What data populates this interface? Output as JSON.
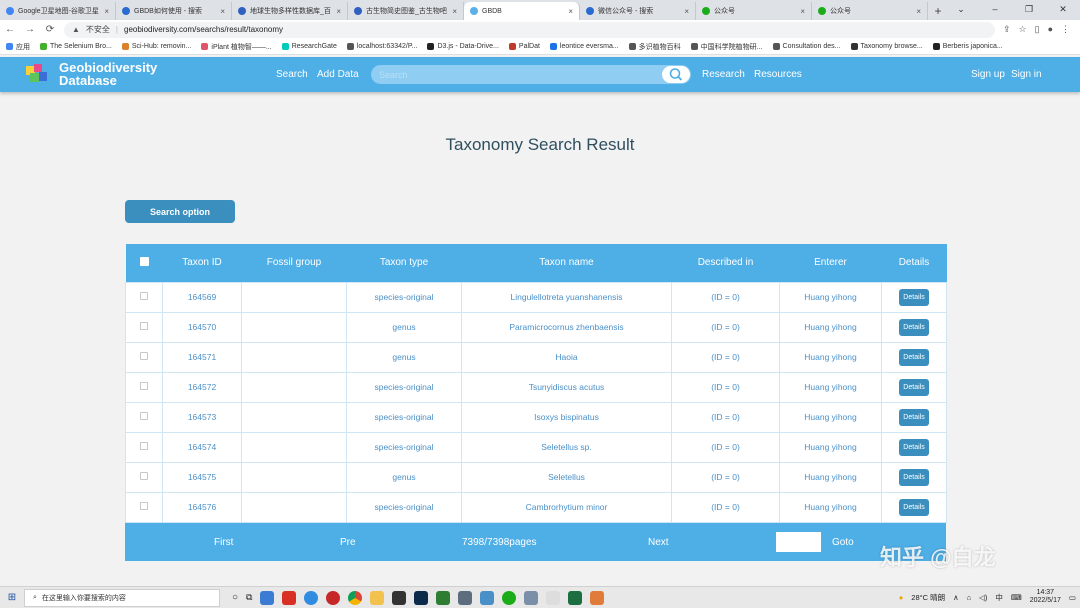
{
  "browser": {
    "tabs": [
      {
        "title": "Google卫星地图-谷歌卫星",
        "color": "#4285f4",
        "active": false
      },
      {
        "title": "GBDB如何使用 - 搜索",
        "color": "#2a6bd1",
        "active": false
      },
      {
        "title": "地球生物多样性数据库_百",
        "color": "#3060c0",
        "active": false
      },
      {
        "title": "古生物简史图鉴_古生物吧",
        "color": "#3060c0",
        "active": false
      },
      {
        "title": "GBDB",
        "color": "#5ab0e8",
        "active": true
      },
      {
        "title": "微信公众号 - 搜索",
        "color": "#2a6bd1",
        "active": false
      },
      {
        "title": "公众号",
        "color": "#1aad19",
        "active": false
      },
      {
        "title": "公众号",
        "color": "#1aad19",
        "active": false
      }
    ],
    "close_glyph": "×",
    "new_tab_glyph": "+",
    "window_controls": [
      "⌄",
      "–",
      "❐",
      "✕"
    ],
    "security_label": "不安全",
    "url": "geobiodiversity.com/searchs/result/taxonomy",
    "bookmarks": [
      {
        "label": "应用",
        "color": "#4285f4"
      },
      {
        "label": "The Selenium Bro...",
        "color": "#43b02a"
      },
      {
        "label": "Sci-Hub: removin...",
        "color": "#d9822b"
      },
      {
        "label": "iPlant 植物智——...",
        "color": "#e0556b"
      },
      {
        "label": "ResearchGate",
        "color": "#00ccbb"
      },
      {
        "label": "localhost:63342/P...",
        "color": "#555555"
      },
      {
        "label": "D3.js - Data-Drive...",
        "color": "#222222"
      },
      {
        "label": "PalDat",
        "color": "#c0392b"
      },
      {
        "label": "leontice eversma...",
        "color": "#1a73e8"
      },
      {
        "label": "多识植物百科",
        "color": "#555555"
      },
      {
        "label": "中国科学院植物研...",
        "color": "#555555"
      },
      {
        "label": "Consultation des...",
        "color": "#555555"
      },
      {
        "label": "Taxonomy browse...",
        "color": "#333333"
      },
      {
        "label": "Berberis japonica...",
        "color": "#222222"
      }
    ]
  },
  "site": {
    "brand_line1": "Geobiodiversity",
    "brand_line2": "Database",
    "nav": {
      "search": "Search",
      "add_data": "Add Data",
      "research": "Research",
      "resources": "Resources",
      "sign_up": "Sign up",
      "sign_in": "Sign in"
    },
    "search_placeholder": "Search",
    "accent": "#4eaee6",
    "button_color": "#3b8fbf"
  },
  "page": {
    "title": "Taxonomy Search Result",
    "search_option": "Search option"
  },
  "table": {
    "headers": [
      "",
      "Taxon ID",
      "Fossil group",
      "Taxon type",
      "Taxon name",
      "Described in",
      "Enterer",
      "Details"
    ],
    "rows": [
      {
        "id": "164569",
        "fossil_group": "",
        "type": "species-original",
        "name": "Lingulellotreta yuanshanensis",
        "described_in": "(ID = 0)",
        "enterer": "Huang yihong",
        "details": "Details"
      },
      {
        "id": "164570",
        "fossil_group": "",
        "type": "genus",
        "name": "Paramicrocornus zhenbaensis",
        "described_in": "(ID = 0)",
        "enterer": "Huang yihong",
        "details": "Details"
      },
      {
        "id": "164571",
        "fossil_group": "",
        "type": "genus",
        "name": "Haoia",
        "described_in": "(ID = 0)",
        "enterer": "Huang yihong",
        "details": "Details"
      },
      {
        "id": "164572",
        "fossil_group": "",
        "type": "species-original",
        "name": "Tsunyidiscus acutus",
        "described_in": "(ID = 0)",
        "enterer": "Huang yihong",
        "details": "Details"
      },
      {
        "id": "164573",
        "fossil_group": "",
        "type": "species-original",
        "name": "Isoxys bispinatus",
        "described_in": "(ID = 0)",
        "enterer": "Huang yihong",
        "details": "Details"
      },
      {
        "id": "164574",
        "fossil_group": "",
        "type": "species-original",
        "name": "Seletellus sp.",
        "described_in": "(ID = 0)",
        "enterer": "Huang yihong",
        "details": "Details"
      },
      {
        "id": "164575",
        "fossil_group": "",
        "type": "genus",
        "name": "Seletellus",
        "described_in": "(ID = 0)",
        "enterer": "Huang yihong",
        "details": "Details"
      },
      {
        "id": "164576",
        "fossil_group": "",
        "type": "species-original",
        "name": "Cambrorhytium minor",
        "described_in": "(ID = 0)",
        "enterer": "Huang yihong",
        "details": "Details"
      }
    ]
  },
  "pager": {
    "first": "First",
    "prev": "Pre",
    "page_info": "7398/7398pages",
    "next": "Next",
    "goto": "Goto"
  },
  "watermark": "知乎 @白龙",
  "taskbar": {
    "search_placeholder": "在这里输入你要搜索的内容",
    "weather": "28°C 晴朗",
    "ime": "中",
    "time": "14:37",
    "date": "2022/5/17"
  }
}
